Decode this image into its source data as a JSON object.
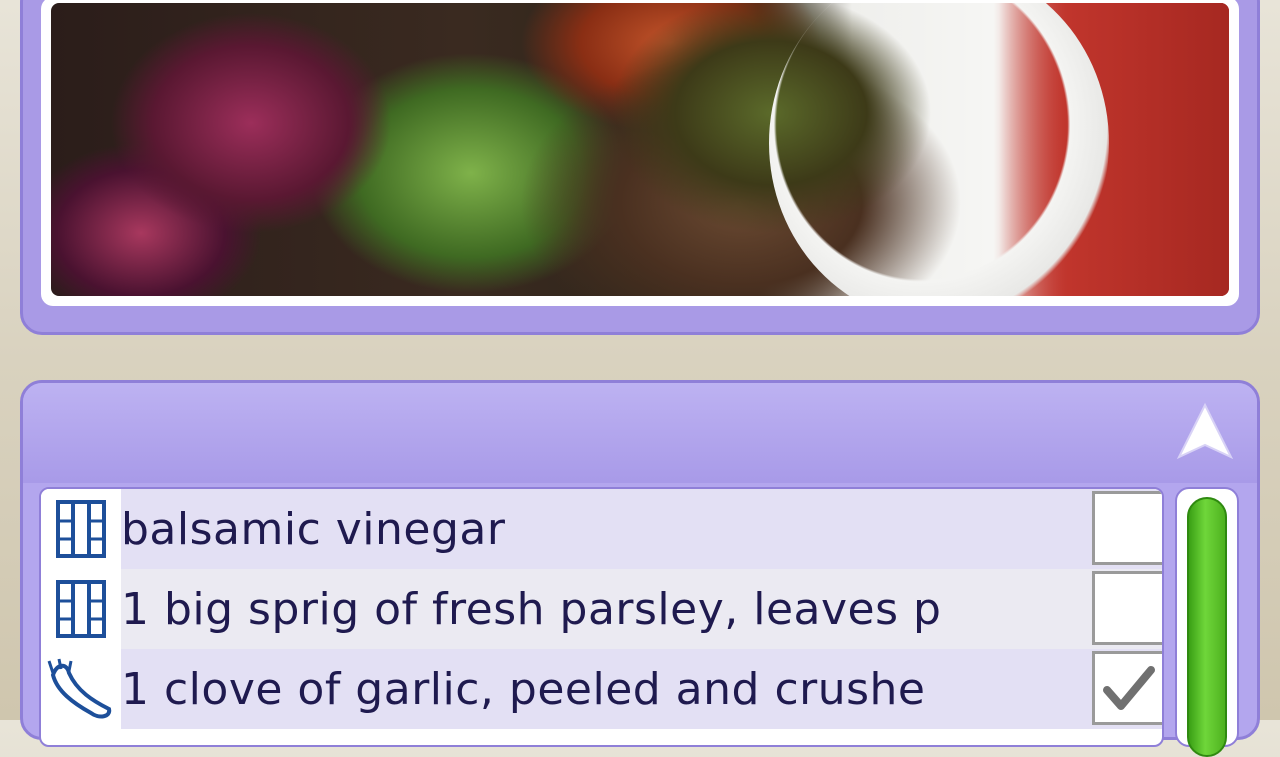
{
  "photo": {
    "subject": "mushroom with salad on white plate"
  },
  "list": {
    "items": [
      {
        "label": "balsamic vinegar",
        "icon": "ingredient-grid-icon",
        "checked": false
      },
      {
        "label": "1 big sprig of fresh parsley, leaves p",
        "icon": "ingredient-grid-icon",
        "checked": false
      },
      {
        "label": "1 clove of garlic, peeled and crushe",
        "icon": "garlic-icon",
        "checked": true
      }
    ]
  },
  "scrollbar": {
    "position": 0.0
  },
  "colors": {
    "panel": "#b3a6ee",
    "panel_border": "#8f7fd8",
    "text": "#1f1a4f",
    "scroll_thumb": "#5cc22a"
  }
}
